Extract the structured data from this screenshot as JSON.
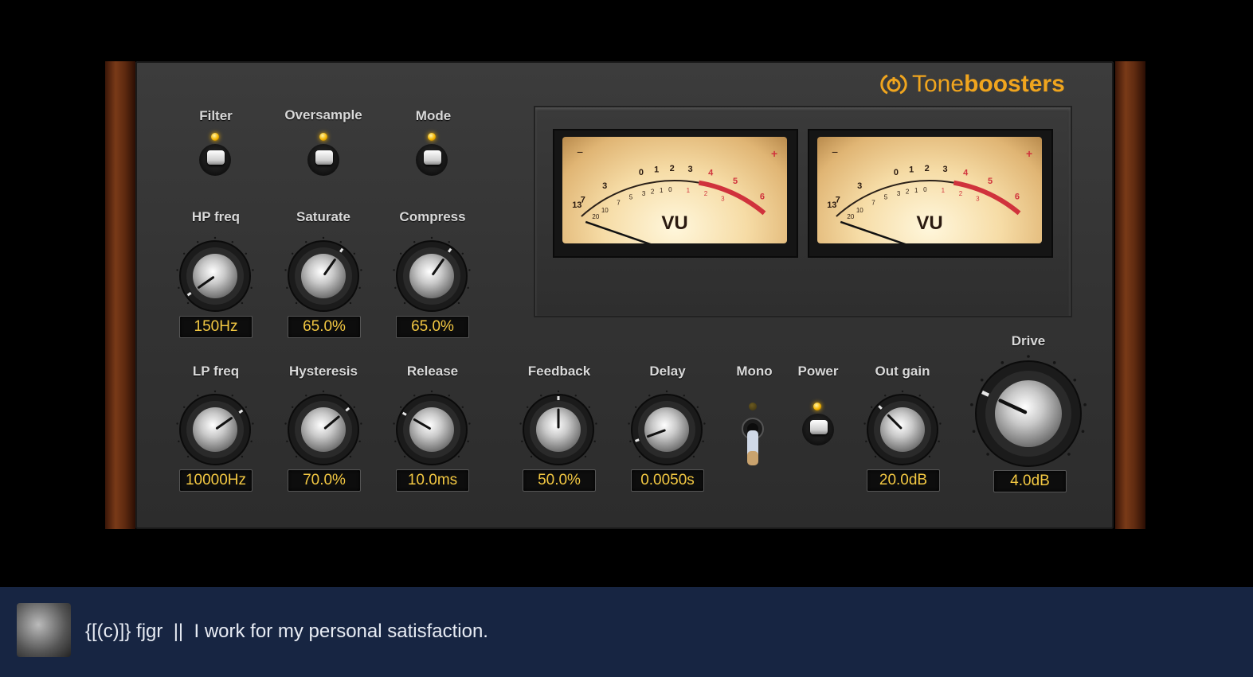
{
  "brand": {
    "name_light": "Tone",
    "name_bold": "boosters",
    "color": "#f0a51e"
  },
  "accent": {
    "display_text": "#f3c842",
    "led": "#f4b400",
    "vu_red": "#d0323c"
  },
  "switches": {
    "filter": {
      "label": "Filter",
      "on": true
    },
    "oversample": {
      "label": "Oversample",
      "on": true
    },
    "mode": {
      "label": "Mode",
      "on": true
    },
    "mono": {
      "label": "Mono",
      "on": false
    },
    "power": {
      "label": "Power",
      "on": true
    }
  },
  "knobs": {
    "hp_freq": {
      "label": "HP freq",
      "value": "150Hz"
    },
    "saturate": {
      "label": "Saturate",
      "value": "65.0%"
    },
    "compress": {
      "label": "Compress",
      "value": "65.0%"
    },
    "lp_freq": {
      "label": "LP freq",
      "value": "10000Hz"
    },
    "hysteresis": {
      "label": "Hysteresis",
      "value": "70.0%"
    },
    "release": {
      "label": "Release",
      "value": "10.0ms"
    },
    "feedback": {
      "label": "Feedback",
      "value": "50.0%"
    },
    "delay": {
      "label": "Delay",
      "value": "0.0050s"
    },
    "out_gain": {
      "label": "Out gain",
      "value": "20.0dB"
    },
    "drive": {
      "label": "Drive",
      "value": "4.0dB"
    }
  },
  "vu_meters": [
    {
      "label": "VU",
      "minus": "−",
      "plus": "+",
      "scale_top": [
        "13",
        "7",
        "3",
        "0",
        "1",
        "2",
        "3",
        "4",
        "5",
        "6"
      ],
      "scale_bottom": [
        "20",
        "10",
        "7",
        "5",
        "3",
        "2",
        "1",
        "0",
        "1",
        "2",
        "3"
      ]
    },
    {
      "label": "VU",
      "minus": "−",
      "plus": "+",
      "scale_top": [
        "13",
        "7",
        "3",
        "0",
        "1",
        "2",
        "3",
        "4",
        "5",
        "6"
      ],
      "scale_bottom": [
        "20",
        "10",
        "7",
        "5",
        "3",
        "2",
        "1",
        "0",
        "1",
        "2",
        "3"
      ]
    }
  ],
  "footer": {
    "status": "{[(c)]} fjgr  ||  I work for my personal satisfaction."
  }
}
